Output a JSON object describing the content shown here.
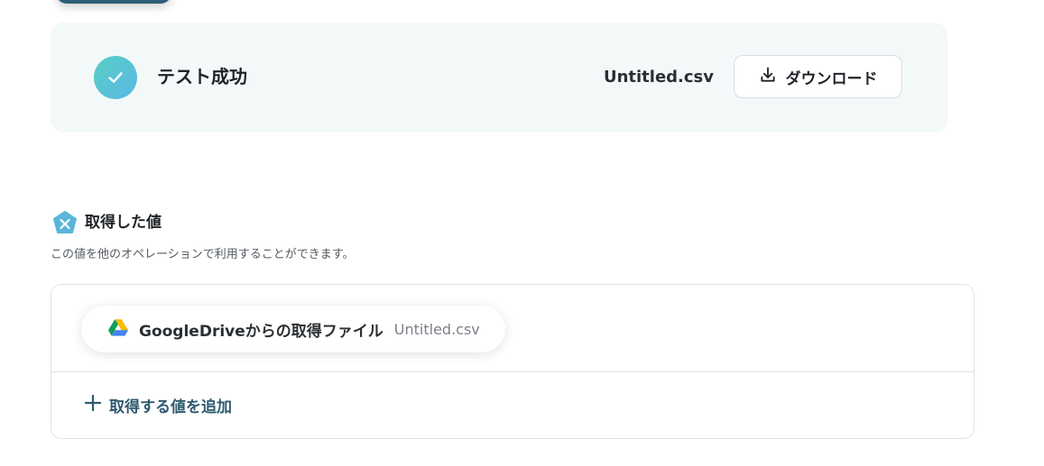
{
  "result": {
    "title": "テスト成功",
    "file_name": "Untitled.csv",
    "download_label": "ダウンロード",
    "status_icon": "check-icon"
  },
  "acquired": {
    "title": "取得した値",
    "description": "この値を他のオペレーションで利用することができます。",
    "icon": "variable-icon",
    "items": [
      {
        "label": "GoogleDriveからの取得ファイル",
        "value": "Untitled.csv",
        "icon": "google-drive-icon"
      }
    ],
    "add_label": "取得する値を追加"
  },
  "colors": {
    "accent": "#2f5a6f",
    "success_gradient_start": "#57cfc5",
    "success_gradient_end": "#5bb8e5",
    "card_bg": "#f3f9f9"
  }
}
